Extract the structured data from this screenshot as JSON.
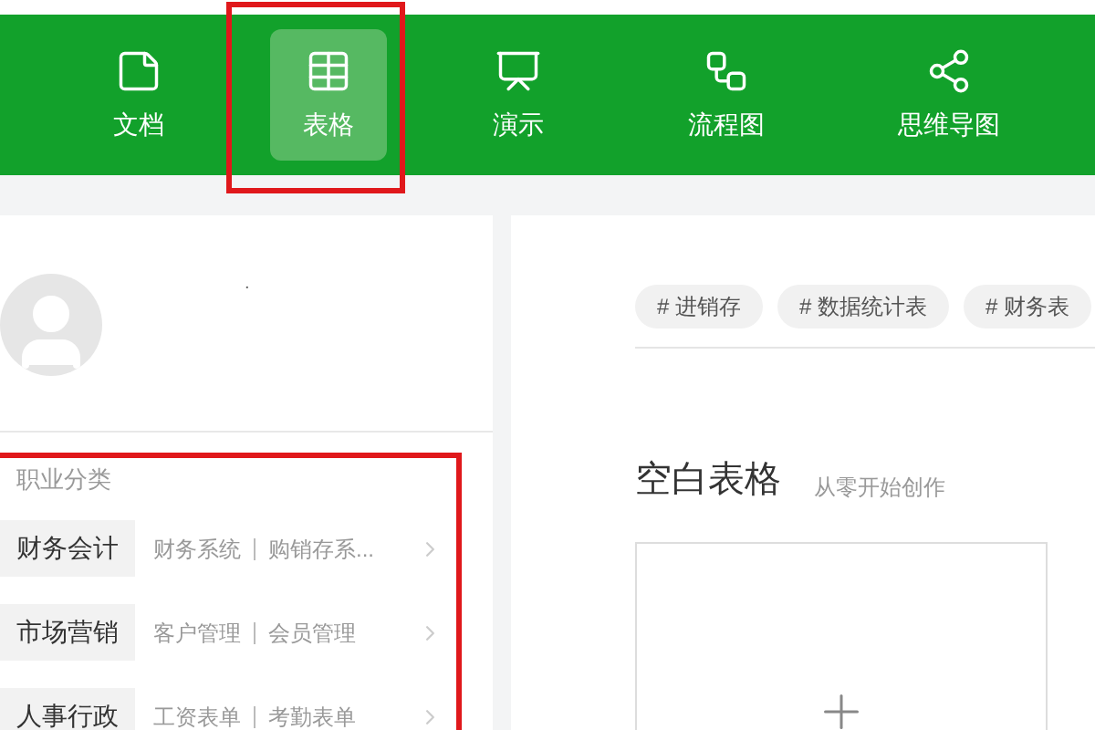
{
  "nav": [
    {
      "label": "文档",
      "kind": "doc",
      "selected": false
    },
    {
      "label": "表格",
      "kind": "sheet",
      "selected": true
    },
    {
      "label": "演示",
      "kind": "slides",
      "selected": false
    },
    {
      "label": "流程图",
      "kind": "flow",
      "selected": false
    },
    {
      "label": "思维导图",
      "kind": "mind",
      "selected": false
    }
  ],
  "profile": {
    "name": "."
  },
  "categories": {
    "title": "职业分类",
    "items": [
      {
        "name": "财务会计",
        "links": [
          "财务系统",
          "购销存系..."
        ]
      },
      {
        "name": "市场营销",
        "links": [
          "客户管理",
          "会员管理"
        ]
      },
      {
        "name": "人事行政",
        "links": [
          "工资表单",
          "考勤表单"
        ]
      }
    ]
  },
  "tags": [
    "# 进销存",
    "# 数据统计表",
    "# 财务表"
  ],
  "blank": {
    "title": "空白表格",
    "subtitle": "从零开始创作"
  }
}
